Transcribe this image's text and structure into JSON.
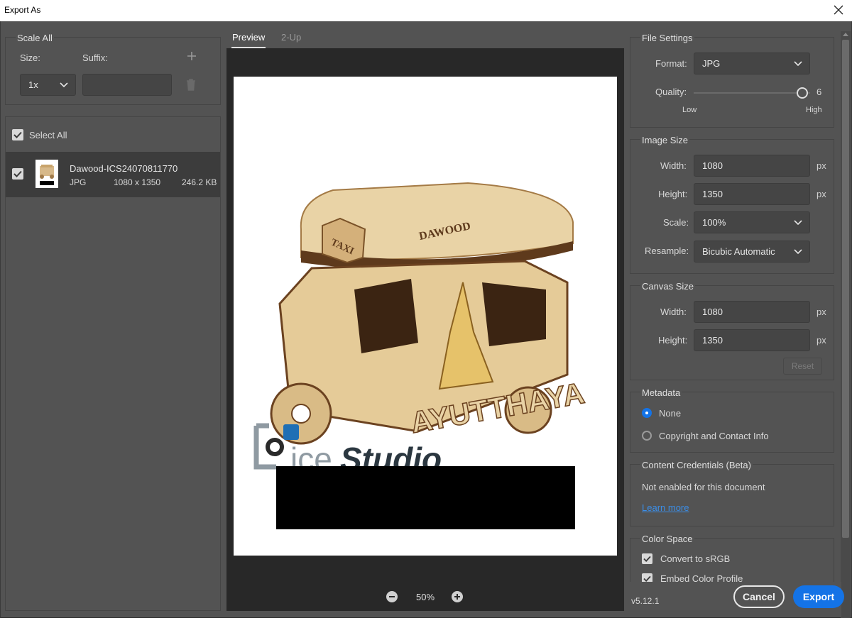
{
  "window": {
    "title": "Export As",
    "close_icon": "close-icon"
  },
  "scale_all": {
    "legend": "Scale All",
    "size_label": "Size:",
    "suffix_label": "Suffix:",
    "size_value": "1x",
    "suffix_value": "",
    "add_icon": "plus-icon",
    "delete_icon": "trash-icon"
  },
  "files": {
    "select_all_label": "Select All",
    "items": [
      {
        "name": "Dawood-ICS24070811770",
        "format": "JPG",
        "dimensions": "1080 x 1350",
        "size": "246.2 KB",
        "checked": true
      }
    ]
  },
  "tabs": [
    {
      "label": "Preview",
      "active": true
    },
    {
      "label": "2-Up",
      "active": false
    }
  ],
  "preview": {
    "watermark_text_1": "ice",
    "watermark_text_2": "Studio",
    "product_text_1": "AYUTTHAYA",
    "product_text_2": "TAXI",
    "product_text_3": "DAWOOD",
    "zoom_level": "50%"
  },
  "file_settings": {
    "legend": "File Settings",
    "format_label": "Format:",
    "format_value": "JPG",
    "quality_label": "Quality:",
    "quality_value": "6",
    "quality_fraction": 0.93,
    "quality_low": "Low",
    "quality_high": "High"
  },
  "image_size": {
    "legend": "Image Size",
    "width_label": "Width:",
    "width_value": "1080",
    "height_label": "Height:",
    "height_value": "1350",
    "scale_label": "Scale:",
    "scale_value": "100%",
    "resample_label": "Resample:",
    "resample_value": "Bicubic Automatic",
    "unit": "px"
  },
  "canvas_size": {
    "legend": "Canvas Size",
    "width_label": "Width:",
    "width_value": "1080",
    "height_label": "Height:",
    "height_value": "1350",
    "unit": "px",
    "reset_label": "Reset"
  },
  "metadata": {
    "legend": "Metadata",
    "options": [
      {
        "label": "None",
        "selected": true
      },
      {
        "label": "Copyright and Contact Info",
        "selected": false
      }
    ]
  },
  "content_credentials": {
    "legend": "Content Credentials (Beta)",
    "status_text": "Not enabled for this document",
    "link_text": "Learn more"
  },
  "color_space": {
    "legend": "Color Space",
    "convert_label": "Convert to sRGB",
    "embed_label": "Embed Color Profile"
  },
  "footer": {
    "version": "v5.12.1",
    "cancel_label": "Cancel",
    "export_label": "Export"
  },
  "colors": {
    "accent": "#1473e6",
    "panel_bg": "#535353",
    "field_bg": "#454545",
    "preview_bg": "#282828"
  }
}
